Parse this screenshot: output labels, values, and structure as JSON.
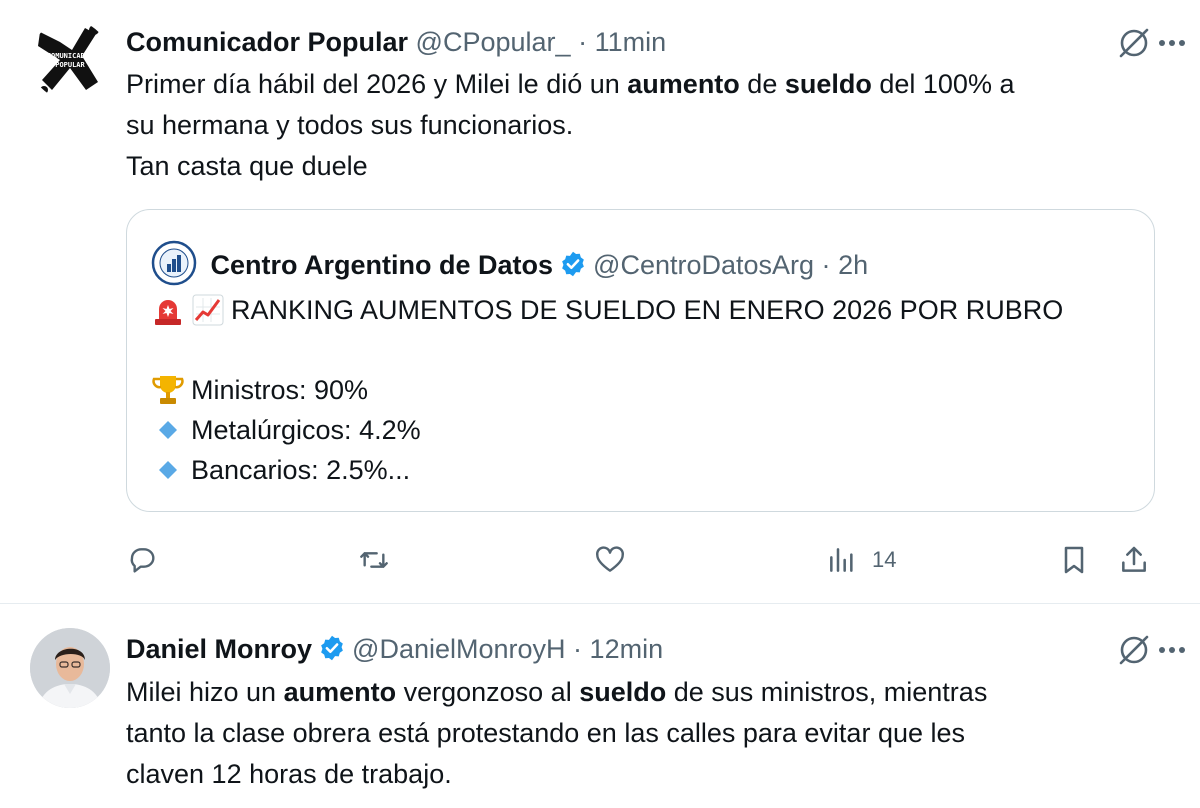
{
  "tweets": [
    {
      "author": {
        "name": "Comunicador Popular",
        "handle": "@CPopular_",
        "avatar_text": "COMUNICADOR POPULAR"
      },
      "time": "11min",
      "body_lines": [
        [
          "Primer día hábil del 2026 y Milei le dió un ",
          "aumento",
          " de ",
          "sueldo",
          " del 100% a"
        ],
        [
          "su hermana y todos sus funcionarios."
        ],
        [
          "Tan casta que duele"
        ]
      ],
      "quote": {
        "author": {
          "name": "Centro Argentino de Datos",
          "handle": "@CentroDatosArg",
          "verified": true
        },
        "time": "2h",
        "headline": "RANKING AUMENTOS DE SUELDO EN ENERO 2026 POR RUBRO",
        "items": [
          "Ministros: 90%",
          "Metalúrgicos: 4.2%",
          "Bancarios: 2.5%..."
        ],
        "emoji": [
          "rotating-light-icon",
          "chart-increasing-icon",
          "trophy-icon",
          "blue-diamond-icon",
          "blue-diamond-icon"
        ]
      },
      "actions": {
        "views": "14"
      }
    },
    {
      "author": {
        "name": "Daniel Monroy",
        "handle": "@DanielMonroyH",
        "verified": true
      },
      "time": "12min",
      "body_lines": [
        [
          "Milei hizo un ",
          "aumento",
          " vergonzoso al ",
          "sueldo",
          " de sus ministros, mientras"
        ],
        [
          "tanto la clase obrera está protestando en las calles para evitar que les"
        ],
        [
          "claven 12 horas de trabajo."
        ]
      ]
    }
  ],
  "separator": "·",
  "colors": {
    "text": "#0f1419",
    "secondary": "#536471",
    "verified": "#1d9bf0",
    "border": "#cfd9de"
  }
}
